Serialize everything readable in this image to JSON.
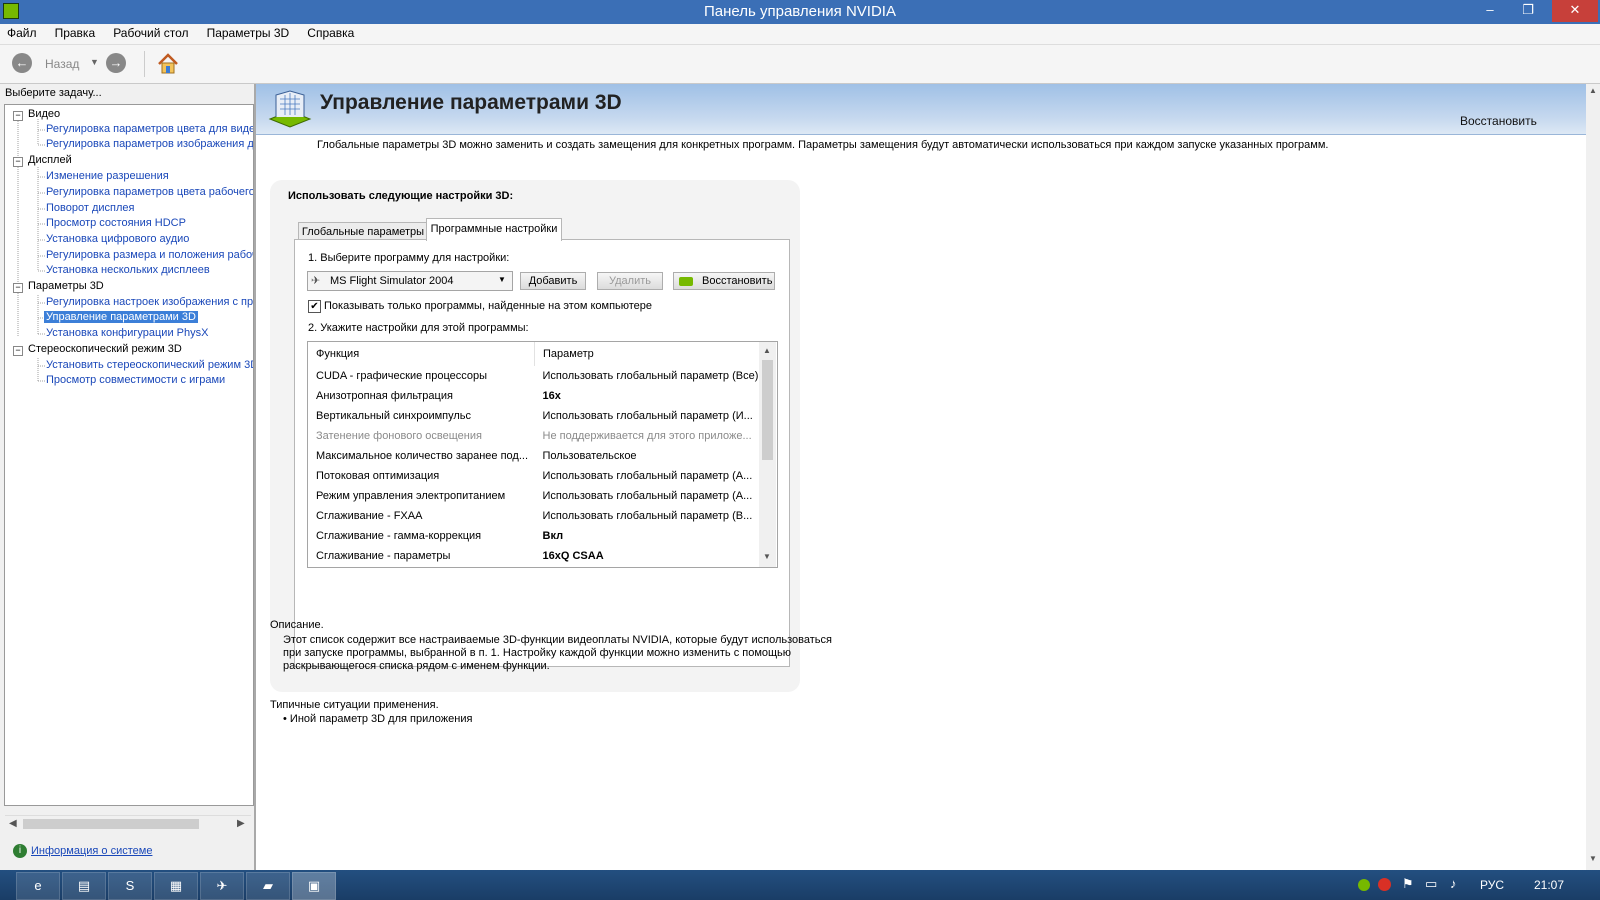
{
  "window": {
    "title": "Панель управления NVIDIA",
    "minimize": "‒",
    "restore": "❐",
    "close": "✕"
  },
  "menu": [
    "Файл",
    "Правка",
    "Рабочий стол",
    "Параметры 3D",
    "Справка"
  ],
  "toolbar": {
    "back_label": "Назад"
  },
  "left": {
    "task_label": "Выберите задачу...",
    "tree": [
      {
        "label": "Видео",
        "children": [
          "Регулировка параметров цвета для видео",
          "Регулировка параметров изображения для видео"
        ]
      },
      {
        "label": "Дисплей",
        "children": [
          "Изменение разрешения",
          "Регулировка параметров цвета рабочего стола",
          "Поворот дисплея",
          "Просмотр состояния HDCP",
          "Установка цифрового аудио",
          "Регулировка размера и положения рабочего стола",
          "Установка нескольких дисплеев"
        ]
      },
      {
        "label": "Параметры 3D",
        "children": [
          "Регулировка настроек изображения с просмотром",
          "Управление параметрами 3D",
          "Установка конфигурации PhysX"
        ]
      },
      {
        "label": "Стереоскопический режим 3D",
        "children": [
          "Установить стереоскопический режим 3D",
          "Просмотр совместимости с играми"
        ]
      }
    ],
    "selected": "Управление параметрами 3D",
    "system_info": "Информация о системе"
  },
  "main": {
    "title": "Управление параметрами 3D",
    "restore_link": "Восстановить",
    "intro": "Глобальные параметры 3D можно заменить и создать замещения для конкретных программ. Параметры замещения будут автоматически использоваться при каждом запуске указанных программ.",
    "use_settings": "Использовать следующие настройки 3D:",
    "tabs": [
      "Глобальные параметры",
      "Программные настройки"
    ],
    "step1": "1. Выберите программу для настройки:",
    "program": "MS Flight Simulator 2004",
    "add_btn": "Добавить",
    "remove_btn": "Удалить",
    "restore_btn": "Восстановить",
    "checkbox_label": "Показывать только программы, найденные на этом компьютере",
    "step2": "2. Укажите настройки для этой программы:",
    "col_function": "Функция",
    "col_param": "Параметр",
    "rows": [
      {
        "f": "CUDA - графические процессоры",
        "p": "Использовать глобальный параметр (Все)",
        "bold": false,
        "disabled": false
      },
      {
        "f": "Анизотропная фильтрация",
        "p": "16x",
        "bold": true,
        "disabled": false
      },
      {
        "f": "Вертикальный синхроимпульс",
        "p": "Использовать глобальный параметр (И...",
        "bold": false,
        "disabled": false
      },
      {
        "f": "Затенение фонового освещения",
        "p": "Не поддерживается для этого приложе...",
        "bold": false,
        "disabled": true
      },
      {
        "f": "Максимальное количество заранее под...",
        "p": "Пользовательское",
        "bold": false,
        "disabled": false
      },
      {
        "f": "Потоковая оптимизация",
        "p": "Использовать глобальный параметр (А...",
        "bold": false,
        "disabled": false
      },
      {
        "f": "Режим управления электропитанием",
        "p": "Использовать глобальный параметр (А...",
        "bold": false,
        "disabled": false
      },
      {
        "f": "Сглаживание - FXAA",
        "p": "Использовать глобальный параметр (В...",
        "bold": false,
        "disabled": false
      },
      {
        "f": "Сглаживание - гамма-коррекция",
        "p": "Вкл",
        "bold": true,
        "disabled": false
      },
      {
        "f": "Сглаживание - параметры",
        "p": "16xQ CSAA",
        "bold": true,
        "disabled": false
      }
    ],
    "description_title": "Описание.",
    "description": "Этот список содержит все настраиваемые 3D-функции видеоплаты NVIDIA, которые будут использоваться при запуске программы, выбранной в п. 1. Настройку каждой функции можно изменить с помощью раскрывающегося списка рядом с именем функции.",
    "typical_title": "Типичные ситуации применения.",
    "typical_item": "Иной параметр 3D для приложения"
  },
  "taskbar": {
    "lang": "РУС",
    "time": "21:07"
  },
  "colors": {
    "titlebar": "#3b6fb6",
    "selection": "#3c7fd8",
    "link": "#1a48b9",
    "nvidia": "#76b900"
  }
}
